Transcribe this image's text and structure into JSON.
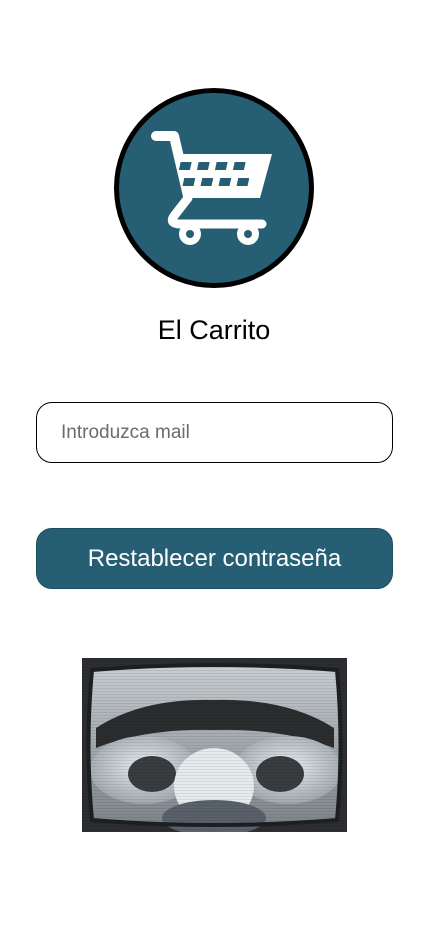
{
  "app": {
    "title": "El Carrito",
    "logo_icon": "shopping-cart-icon"
  },
  "form": {
    "email_placeholder": "Introduzca mail",
    "email_value": "",
    "reset_label": "Restablecer contraseña"
  },
  "media": {
    "thumbnail_icon": "video-thumbnail"
  },
  "colors": {
    "brand": "#265f73",
    "button_text": "#ffffff",
    "page_background": "#ffffff"
  }
}
